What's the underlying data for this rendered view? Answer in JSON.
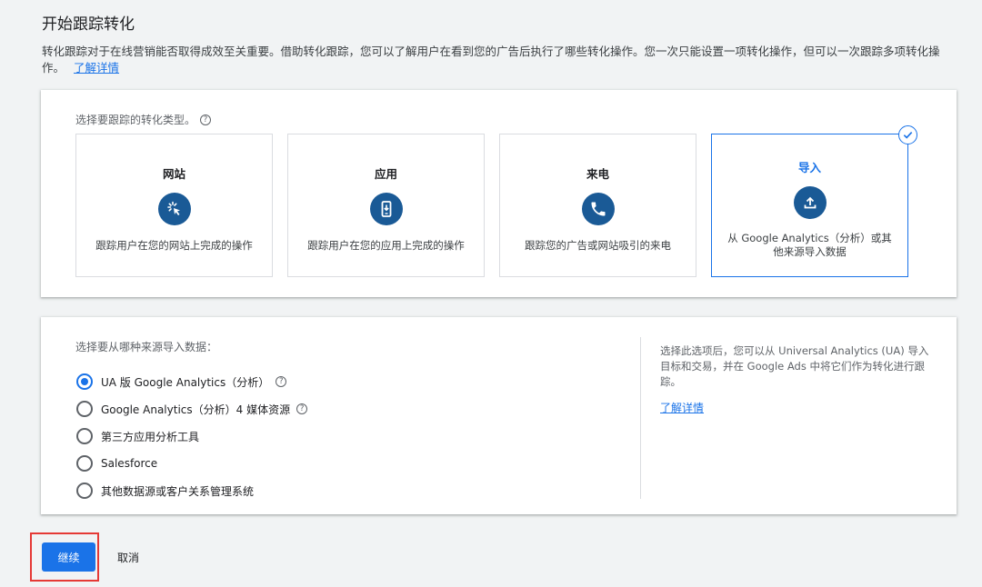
{
  "page": {
    "title": "开始跟踪转化",
    "intro": "转化跟踪对于在线营销能否取得成效至关重要。借助转化跟踪，您可以了解用户在看到您的广告后执行了哪些转化操作。您一次只能设置一项转化操作，但可以一次跟踪多项转化操作。",
    "learn_more": "了解详情"
  },
  "conversion_type": {
    "label": "选择要跟踪的转化类型。",
    "tiles": [
      {
        "title": "网站",
        "desc": "跟踪用户在您的网站上完成的操作",
        "icon": "cursor-click-icon",
        "selected": false
      },
      {
        "title": "应用",
        "desc": "跟踪用户在您的应用上完成的操作",
        "icon": "mobile-app-icon",
        "selected": false
      },
      {
        "title": "来电",
        "desc": "跟踪您的广告或网站吸引的来电",
        "icon": "phone-icon",
        "selected": false
      },
      {
        "title": "导入",
        "desc": "从 Google Analytics（分析）或其他来源导入数据",
        "icon": "upload-icon",
        "selected": true
      }
    ]
  },
  "import_source": {
    "label": "选择要从哪种来源导入数据：",
    "options": [
      {
        "label": "UA 版 Google Analytics（分析）",
        "checked": true,
        "help": true
      },
      {
        "label": "Google Analytics（分析）4 媒体资源",
        "checked": false,
        "help": true
      },
      {
        "label": "第三方应用分析工具",
        "checked": false,
        "help": false
      },
      {
        "label": "Salesforce",
        "checked": false,
        "help": false
      },
      {
        "label": "其他数据源或客户关系管理系统",
        "checked": false,
        "help": false
      }
    ],
    "info": "选择此选项后，您可以从 Universal Analytics (UA) 导入目标和交易，并在 Google Ads 中将它们作为转化进行跟踪。",
    "info_link": "了解详情"
  },
  "actions": {
    "continue": "继续",
    "cancel": "取消"
  },
  "colors": {
    "accent": "#1a73e8",
    "icon_bg": "#1a5a96",
    "highlight": "#e53935"
  }
}
